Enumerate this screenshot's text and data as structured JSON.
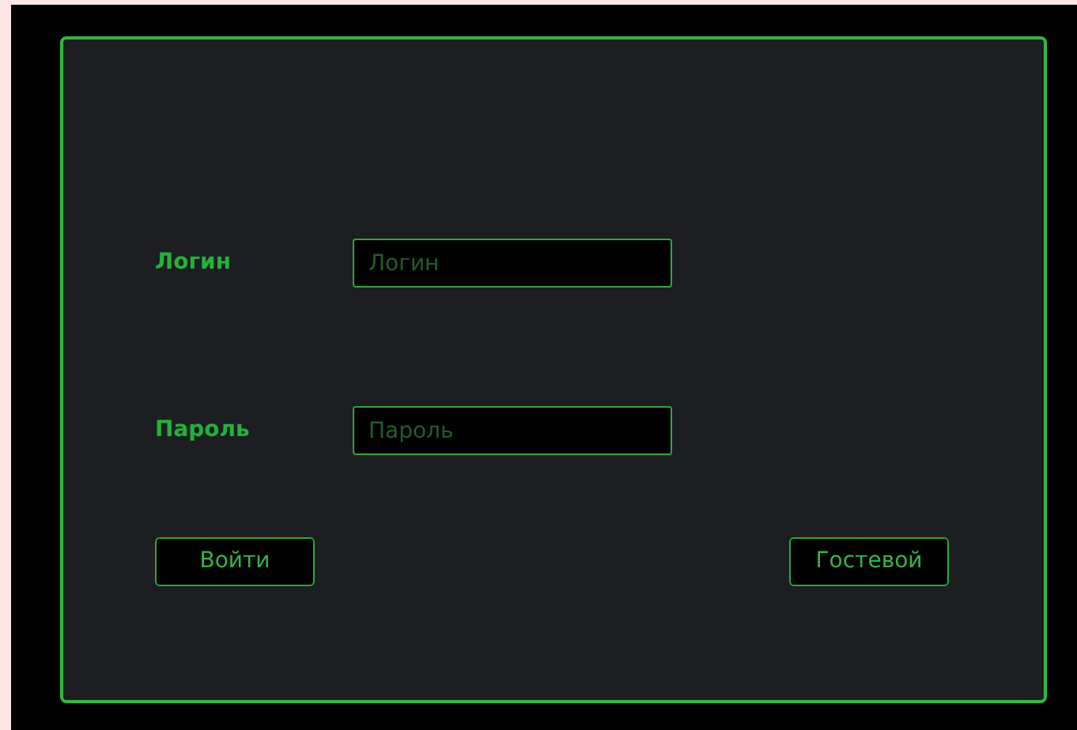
{
  "fields": [
    {
      "label": "Логин",
      "placeholder": "Логин"
    },
    {
      "label": "Пароль",
      "placeholder": "Пароль"
    }
  ],
  "buttons": [
    "Войти",
    "Гостевой"
  ]
}
